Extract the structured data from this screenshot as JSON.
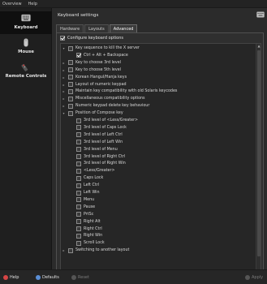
{
  "menubar": {
    "items": [
      "Overview",
      "Help"
    ]
  },
  "sidebar": {
    "items": [
      {
        "label": "Keyboard",
        "icon": "keyboard-icon",
        "active": true
      },
      {
        "label": "Mouse",
        "icon": "mouse-icon",
        "active": false
      },
      {
        "label": "Remote Controls",
        "icon": "remote-control-icon",
        "active": false
      }
    ]
  },
  "header": {
    "title": "Keyboard settings"
  },
  "tabs": [
    {
      "label": "Hardware",
      "active": false
    },
    {
      "label": "Layouts",
      "active": false
    },
    {
      "label": "Advanced",
      "active": true
    }
  ],
  "configure": {
    "label": "Configure keyboard options",
    "checked": true
  },
  "tree": {
    "rows": [
      {
        "label": "Key sequence to kill the X server",
        "indent": 0,
        "expander": "open",
        "checkbox": true,
        "checked": false
      },
      {
        "label": "Ctrl + Alt + Backspace",
        "indent": 1,
        "expander": "none",
        "checkbox": true,
        "checked": true
      },
      {
        "label": "Key to choose 3rd level",
        "indent": 0,
        "expander": "closed",
        "checkbox": true,
        "checked": false
      },
      {
        "label": "Key to choose 5th level",
        "indent": 0,
        "expander": "closed",
        "checkbox": true,
        "checked": false
      },
      {
        "label": "Korean Hangul/Hanja keys",
        "indent": 0,
        "expander": "closed",
        "checkbox": true,
        "checked": false
      },
      {
        "label": "Layout of numeric keypad",
        "indent": 0,
        "expander": "closed",
        "checkbox": true,
        "checked": false
      },
      {
        "label": "Maintain key compatibility with old Solaris keycodes",
        "indent": 0,
        "expander": "closed",
        "checkbox": true,
        "checked": false
      },
      {
        "label": "Miscellaneous compatibility options",
        "indent": 0,
        "expander": "closed",
        "checkbox": true,
        "checked": false
      },
      {
        "label": "Numeric keypad delete key behaviour",
        "indent": 0,
        "expander": "closed",
        "checkbox": true,
        "checked": false
      },
      {
        "label": "Position of Compose key",
        "indent": 0,
        "expander": "open",
        "checkbox": true,
        "checked": false
      },
      {
        "label": "3rd level of <Less/Greater>",
        "indent": 1,
        "expander": "none",
        "checkbox": true,
        "checked": false
      },
      {
        "label": "3rd level of Caps Lock",
        "indent": 1,
        "expander": "none",
        "checkbox": true,
        "checked": false
      },
      {
        "label": "3rd level of Left Ctrl",
        "indent": 1,
        "expander": "none",
        "checkbox": true,
        "checked": false
      },
      {
        "label": "3rd level of Left Win",
        "indent": 1,
        "expander": "none",
        "checkbox": true,
        "checked": false
      },
      {
        "label": "3rd level of Menu",
        "indent": 1,
        "expander": "none",
        "checkbox": true,
        "checked": false
      },
      {
        "label": "3rd level of Right Ctrl",
        "indent": 1,
        "expander": "none",
        "checkbox": true,
        "checked": false
      },
      {
        "label": "3rd level of Right Win",
        "indent": 1,
        "expander": "none",
        "checkbox": true,
        "checked": false
      },
      {
        "label": "<Less/Greater>",
        "indent": 1,
        "expander": "none",
        "checkbox": true,
        "checked": false
      },
      {
        "label": "Caps Lock",
        "indent": 1,
        "expander": "none",
        "checkbox": true,
        "checked": false
      },
      {
        "label": "Left Ctrl",
        "indent": 1,
        "expander": "none",
        "checkbox": true,
        "checked": false
      },
      {
        "label": "Left Win",
        "indent": 1,
        "expander": "none",
        "checkbox": true,
        "checked": false
      },
      {
        "label": "Menu",
        "indent": 1,
        "expander": "none",
        "checkbox": true,
        "checked": false
      },
      {
        "label": "Pause",
        "indent": 1,
        "expander": "none",
        "checkbox": true,
        "checked": false
      },
      {
        "label": "PrtSc",
        "indent": 1,
        "expander": "none",
        "checkbox": true,
        "checked": false
      },
      {
        "label": "Right Alt",
        "indent": 1,
        "expander": "none",
        "checkbox": true,
        "checked": false
      },
      {
        "label": "Right Ctrl",
        "indent": 1,
        "expander": "none",
        "checkbox": true,
        "checked": false
      },
      {
        "label": "Right Win",
        "indent": 1,
        "expander": "none",
        "checkbox": true,
        "checked": false
      },
      {
        "label": "Scroll Lock",
        "indent": 1,
        "expander": "none",
        "checkbox": true,
        "checked": false
      },
      {
        "label": "Switching to another layout",
        "indent": 0,
        "expander": "closed",
        "checkbox": true,
        "checked": false
      }
    ]
  },
  "bottom": {
    "help": "Help",
    "defaults": "Defaults",
    "reset": "Reset",
    "apply": "Apply"
  }
}
